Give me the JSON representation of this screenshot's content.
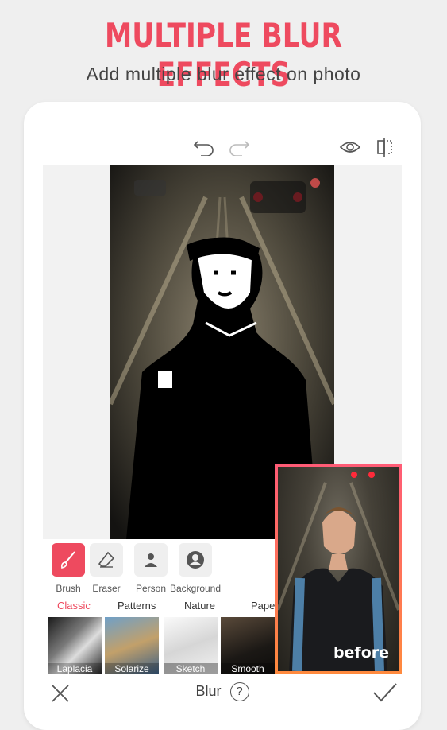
{
  "promo": {
    "headline": "MULTIPLE BLUR EFFECTS",
    "subhead": "Add multiple blur effect on photo"
  },
  "topbar": {
    "undo_icon": "undo-icon",
    "redo_icon": "redo-icon",
    "preview_icon": "eye-icon",
    "compare_icon": "compare-icon"
  },
  "before_label": "before",
  "tools": [
    {
      "label": "Brush",
      "icon": "brush-icon",
      "active": true
    },
    {
      "label": "Eraser",
      "icon": "eraser-icon",
      "active": false
    },
    {
      "label": "Person",
      "icon": "person-icon",
      "active": false
    },
    {
      "label": "Background",
      "icon": "background-icon",
      "active": false
    }
  ],
  "tabs": [
    {
      "label": "Classic",
      "active": true
    },
    {
      "label": "Patterns",
      "active": false
    },
    {
      "label": "Nature",
      "active": false
    },
    {
      "label": "Paper",
      "active": false
    }
  ],
  "filters": [
    {
      "label": "Laplacia"
    },
    {
      "label": "Solarize"
    },
    {
      "label": "Sketch"
    },
    {
      "label": "Smooth"
    }
  ],
  "bottombar": {
    "title": "Blur",
    "help_icon": "help-icon",
    "cancel_icon": "close-icon",
    "confirm_icon": "check-icon"
  },
  "colors": {
    "accent": "#ee4a5f",
    "before_gradient": [
      "#ff5b76",
      "#ff8a3d"
    ]
  }
}
